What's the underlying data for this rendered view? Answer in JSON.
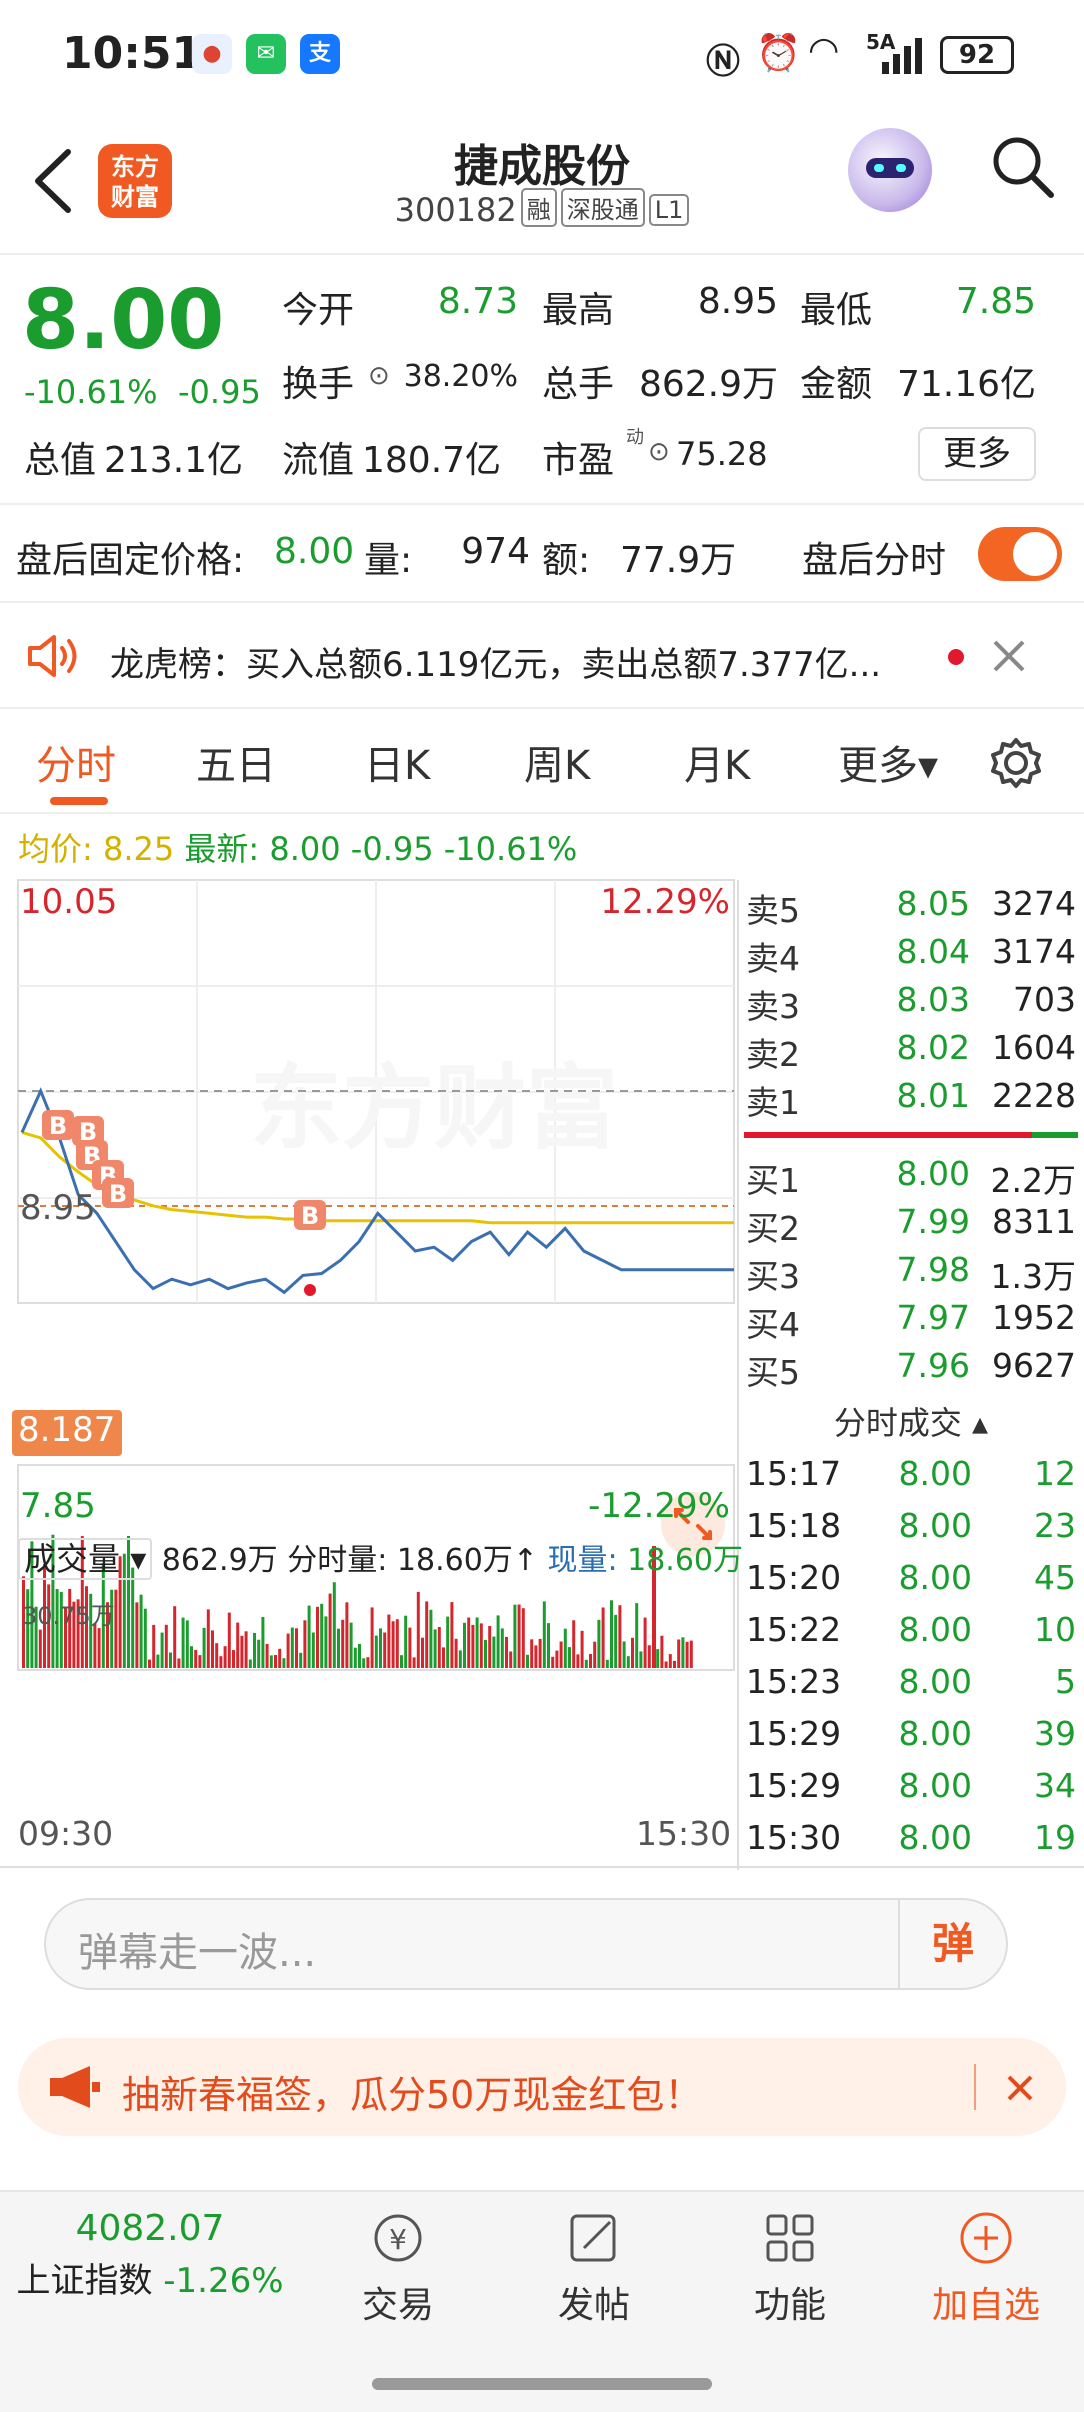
{
  "status_bar": {
    "time": "10:51",
    "battery": "92",
    "network": "5A"
  },
  "header": {
    "stock_name": "捷成股份",
    "stock_code": "300182",
    "tags": [
      "融",
      "深股通",
      "L1"
    ],
    "logo_text_line1": "东方",
    "logo_text_line2": "财富"
  },
  "quote": {
    "price": "8.00",
    "change_pct": "-10.61%",
    "change": "-0.95",
    "open_label": "今开",
    "open": "8.73",
    "high_label": "最高",
    "high": "8.95",
    "low_label": "最低",
    "low": "7.85",
    "turnover_label": "换手",
    "turnover": "38.20%",
    "volume_label": "总手",
    "volume": "862.9万",
    "amount_label": "金额",
    "amount": "71.16亿",
    "mktcap_label": "总值",
    "mktcap": "213.1亿",
    "float_label": "流值",
    "float_cap": "180.7亿",
    "pe_label": "市盈",
    "pe_sup": "动",
    "pe": "75.28",
    "more_label": "更多"
  },
  "after_hours": {
    "price_label": "盘后固定价格:",
    "price": "8.00",
    "volume_label": "量:",
    "volume": "974",
    "amount_label": "额:",
    "amount": "77.9万",
    "toggle_label": "盘后分时"
  },
  "notice": {
    "text": "龙虎榜：买入总额6.119亿元，卖出总额7.377亿..."
  },
  "tabs": [
    {
      "label": "分时",
      "active": true
    },
    {
      "label": "五日"
    },
    {
      "label": "日K"
    },
    {
      "label": "周K"
    },
    {
      "label": "月K"
    },
    {
      "label": "更多▾"
    }
  ],
  "avg_line": {
    "avg_label": "均价:",
    "avg": "8.25",
    "latest_label": "最新:",
    "latest": "8.00",
    "change": "-0.95",
    "change_pct": "-10.61%"
  },
  "chart": {
    "y_max": "10.05",
    "y_max_pct": "12.29%",
    "y_min": "7.85",
    "y_min_pct": "-12.29%",
    "ref_price": "8.95",
    "cursor_price": "8.187",
    "time_start": "09:30",
    "time_end": "15:30",
    "vol_max": "30.75万",
    "volume_bar_label": "成交量",
    "volume_bar_value": "862.9万",
    "period_vol_label": "分时量:",
    "period_vol": "18.60万↑",
    "cur_vol_label": "现量:",
    "cur_vol": "18.60万"
  },
  "chart_data": {
    "type": "line",
    "title": "",
    "xlabel": "",
    "ylabel": "",
    "x_range": [
      "09:30",
      "15:30"
    ],
    "ylim": [
      7.85,
      10.05
    ],
    "ref_price": 8.95,
    "series": [
      {
        "name": "分时",
        "values": [
          8.73,
          8.95,
          8.7,
          8.4,
          8.3,
          8.15,
          8.0,
          7.9,
          7.95,
          7.92,
          7.95,
          7.9,
          7.93,
          7.95,
          7.88,
          7.97,
          7.98,
          8.05,
          8.15,
          8.3,
          8.2,
          8.1,
          8.12,
          8.05,
          8.15,
          8.2,
          8.08,
          8.2,
          8.12,
          8.22,
          8.1,
          8.05,
          8.0,
          8.0
        ]
      },
      {
        "name": "均价",
        "values": [
          8.73,
          8.7,
          8.6,
          8.52,
          8.45,
          8.4,
          8.37,
          8.34,
          8.32,
          8.31,
          8.3,
          8.29,
          8.28,
          8.28,
          8.27,
          8.27,
          8.26,
          8.26,
          8.26,
          8.26,
          8.26,
          8.26,
          8.26,
          8.26,
          8.26,
          8.25,
          8.25,
          8.25,
          8.25,
          8.25,
          8.25,
          8.25,
          8.25,
          8.25
        ]
      }
    ]
  },
  "order_book": {
    "asks": [
      {
        "label": "卖5",
        "price": "8.05",
        "vol": "3274"
      },
      {
        "label": "卖4",
        "price": "8.04",
        "vol": "3174"
      },
      {
        "label": "卖3",
        "price": "8.03",
        "vol": "703"
      },
      {
        "label": "卖2",
        "price": "8.02",
        "vol": "1604"
      },
      {
        "label": "卖1",
        "price": "8.01",
        "vol": "2228"
      }
    ],
    "bids": [
      {
        "label": "买1",
        "price": "8.00",
        "vol": "2.2万"
      },
      {
        "label": "买2",
        "price": "7.99",
        "vol": "8311"
      },
      {
        "label": "买3",
        "price": "7.98",
        "vol": "1.3万"
      },
      {
        "label": "买4",
        "price": "7.97",
        "vol": "1952"
      },
      {
        "label": "买5",
        "price": "7.96",
        "vol": "9627"
      }
    ]
  },
  "ticks": {
    "title": "分时成交 ▴",
    "rows": [
      {
        "time": "15:17",
        "price": "8.00",
        "vol": "12"
      },
      {
        "time": "15:18",
        "price": "8.00",
        "vol": "23"
      },
      {
        "time": "15:20",
        "price": "8.00",
        "vol": "45"
      },
      {
        "time": "15:22",
        "price": "8.00",
        "vol": "10"
      },
      {
        "time": "15:23",
        "price": "8.00",
        "vol": "5"
      },
      {
        "time": "15:29",
        "price": "8.00",
        "vol": "39"
      },
      {
        "time": "15:29",
        "price": "8.00",
        "vol": "34"
      },
      {
        "time": "15:30",
        "price": "8.00",
        "vol": "19"
      }
    ]
  },
  "danmaku": {
    "placeholder": "弹幕走一波...",
    "button": "弹"
  },
  "promo": {
    "text": "抽新春福签，瓜分50万现金红包！"
  },
  "bottom_bar": {
    "index_value": "4082.07",
    "index_name": "上证指数",
    "index_change": "-1.26%",
    "items": [
      {
        "label": "交易",
        "icon": "yen-icon"
      },
      {
        "label": "发帖",
        "icon": "edit-icon"
      },
      {
        "label": "功能",
        "icon": "grid-icon"
      },
      {
        "label": "加自选",
        "icon": "plus-circle-icon"
      }
    ]
  },
  "colors": {
    "accent": "#f05a22",
    "down": "#1a9c2e",
    "up": "#d6262d",
    "avg": "#e6c200",
    "line": "#3a6fb0"
  }
}
